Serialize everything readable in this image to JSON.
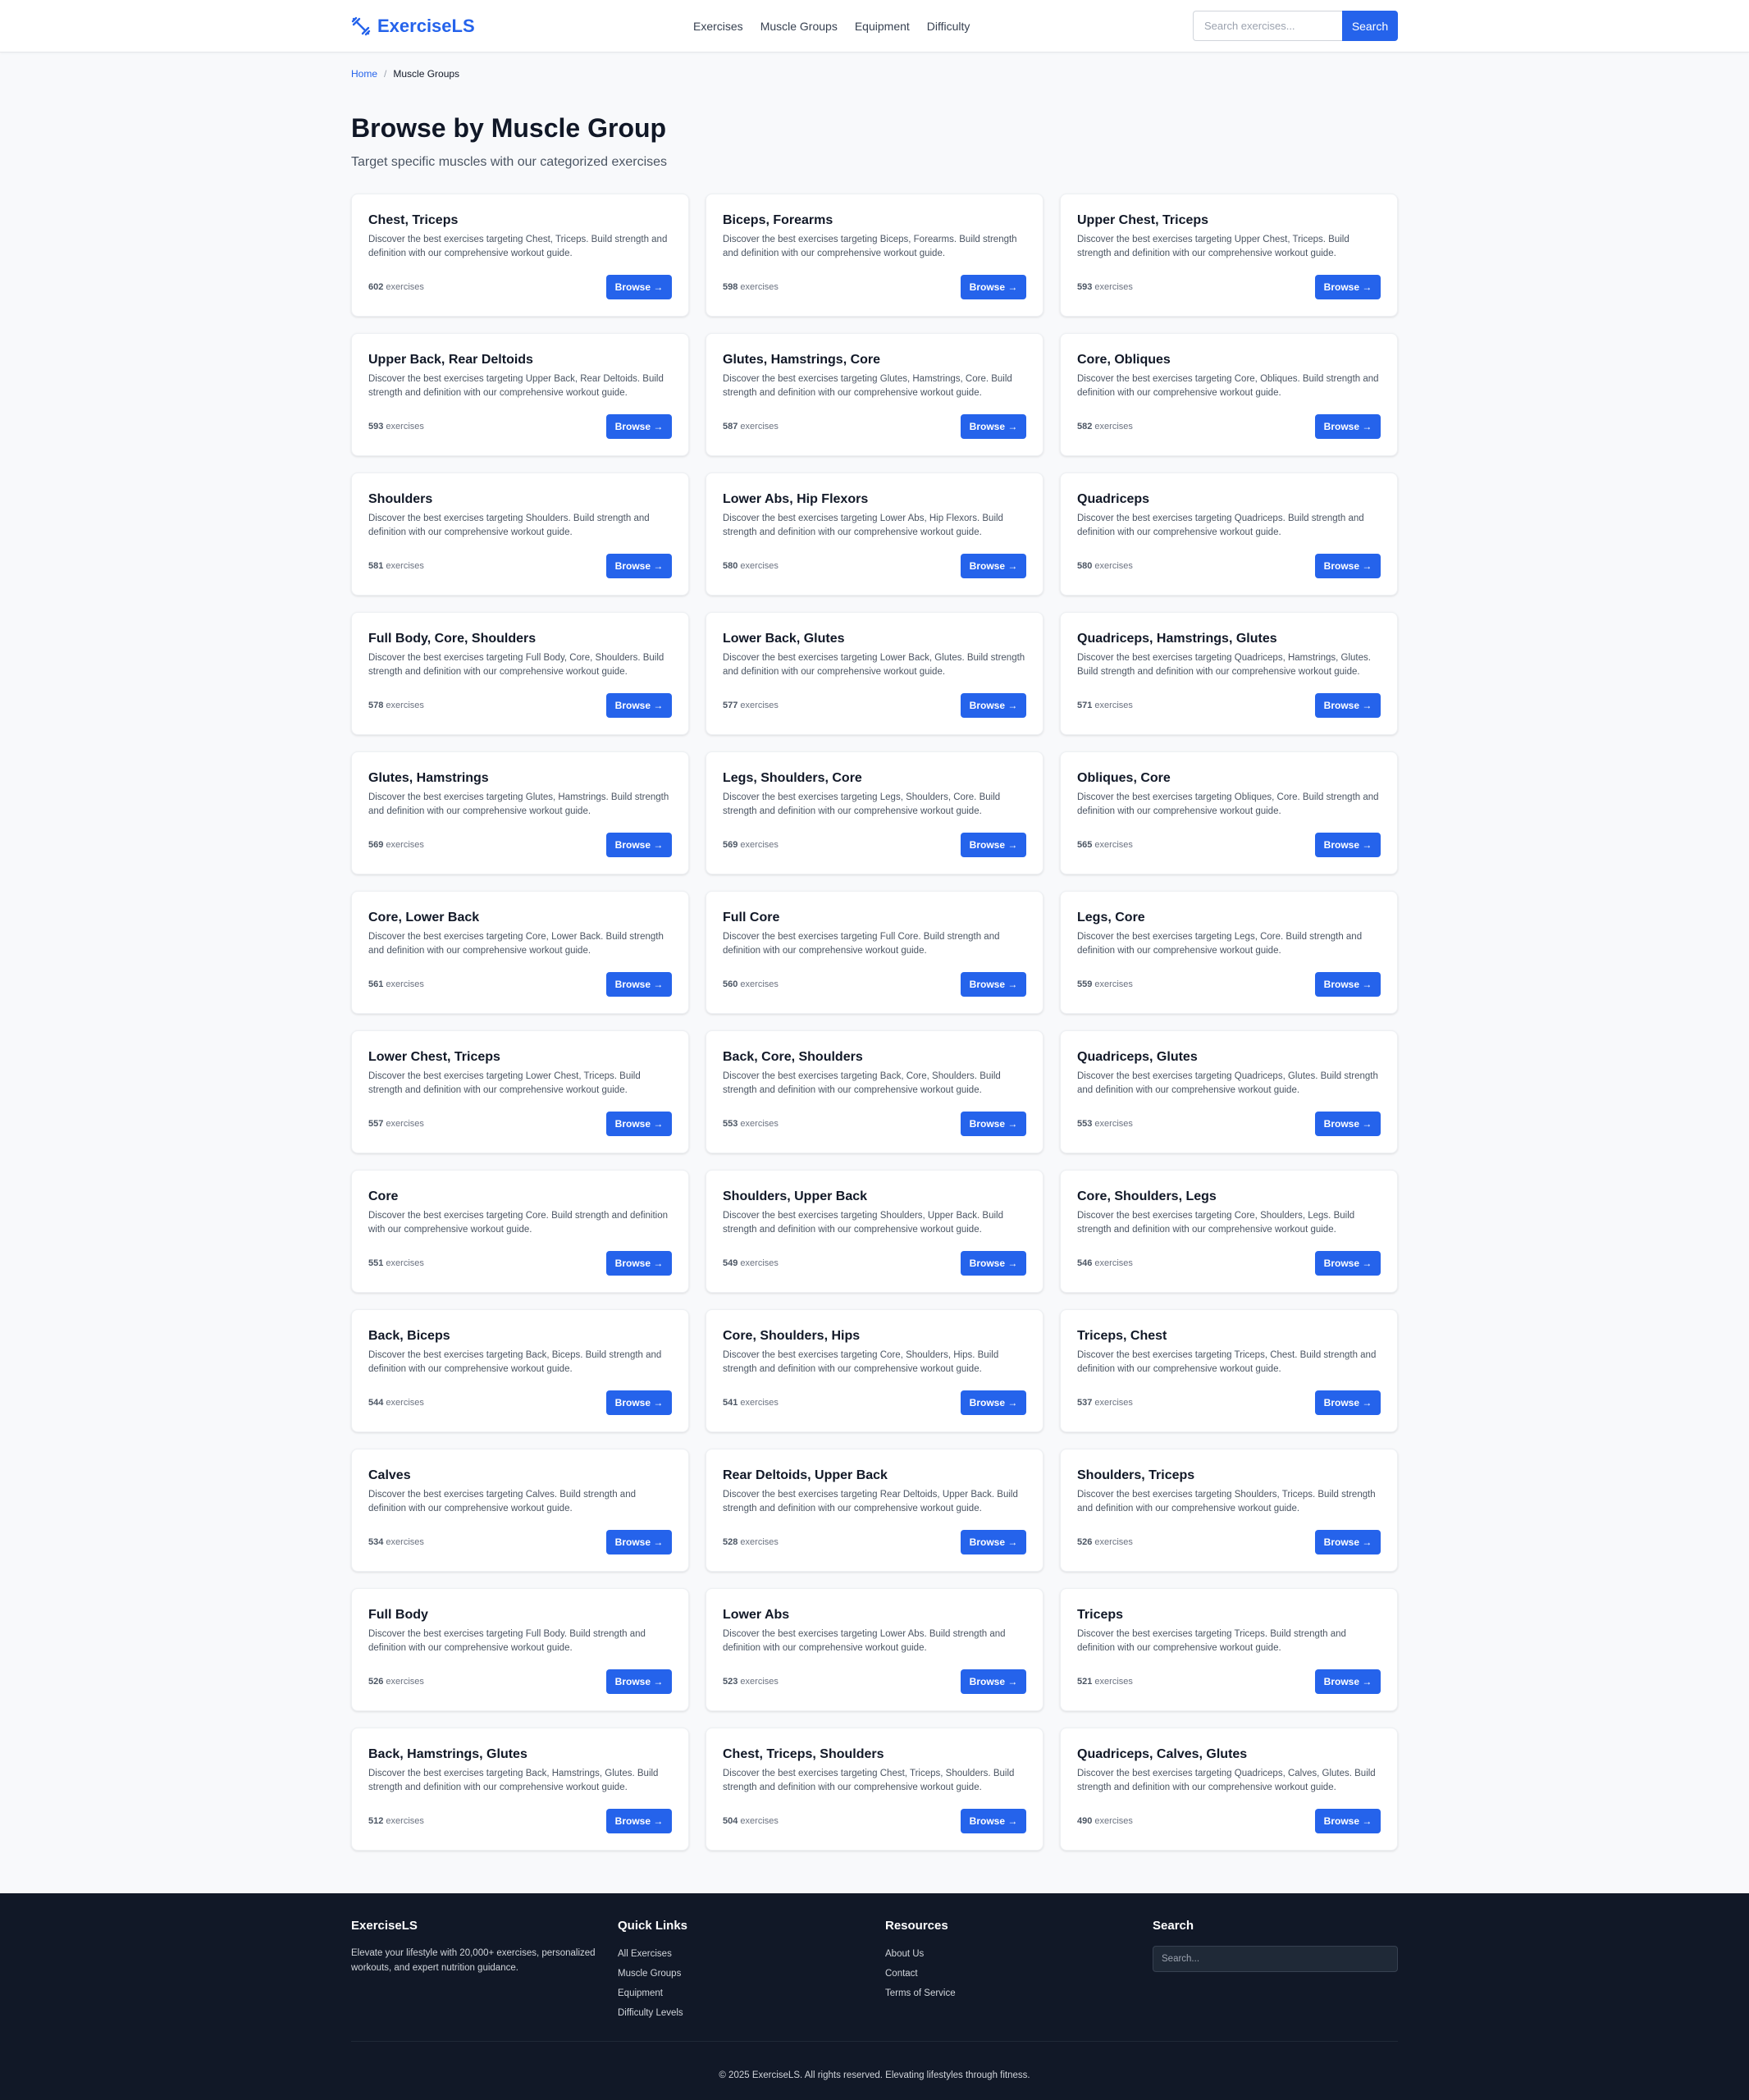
{
  "header": {
    "brand": "ExerciseLS",
    "brand_icon": "dumbbell-icon",
    "nav": [
      "Exercises",
      "Muscle Groups",
      "Equipment",
      "Difficulty"
    ],
    "search_placeholder": "Search exercises...",
    "search_button": "Search"
  },
  "breadcrumb": {
    "home": "Home",
    "separator": "/",
    "current": "Muscle Groups"
  },
  "page": {
    "title": "Browse by Muscle Group",
    "subtitle": "Target specific muscles with our categorized exercises"
  },
  "card_labels": {
    "count_suffix": " exercises",
    "button": "Browse →"
  },
  "cards": [
    {
      "title": "Chest, Triceps",
      "description": "Discover the best exercises targeting Chest, Triceps. Build strength and definition with our comprehensive workout guide.",
      "count": "602"
    },
    {
      "title": "Biceps, Forearms",
      "description": "Discover the best exercises targeting Biceps, Forearms. Build strength and definition with our comprehensive workout guide.",
      "count": "598"
    },
    {
      "title": "Upper Chest, Triceps",
      "description": "Discover the best exercises targeting Upper Chest, Triceps. Build strength and definition with our comprehensive workout guide.",
      "count": "593"
    },
    {
      "title": "Upper Back, Rear Deltoids",
      "description": "Discover the best exercises targeting Upper Back, Rear Deltoids. Build strength and definition with our comprehensive workout guide.",
      "count": "593"
    },
    {
      "title": "Glutes, Hamstrings, Core",
      "description": "Discover the best exercises targeting Glutes, Hamstrings, Core. Build strength and definition with our comprehensive workout guide.",
      "count": "587"
    },
    {
      "title": "Core, Obliques",
      "description": "Discover the best exercises targeting Core, Obliques. Build strength and definition with our comprehensive workout guide.",
      "count": "582"
    },
    {
      "title": "Shoulders",
      "description": "Discover the best exercises targeting Shoulders. Build strength and definition with our comprehensive workout guide.",
      "count": "581"
    },
    {
      "title": "Lower Abs, Hip Flexors",
      "description": "Discover the best exercises targeting Lower Abs, Hip Flexors. Build strength and definition with our comprehensive workout guide.",
      "count": "580"
    },
    {
      "title": "Quadriceps",
      "description": "Discover the best exercises targeting Quadriceps. Build strength and definition with our comprehensive workout guide.",
      "count": "580"
    },
    {
      "title": "Full Body, Core, Shoulders",
      "description": "Discover the best exercises targeting Full Body, Core, Shoulders. Build strength and definition with our comprehensive workout guide.",
      "count": "578"
    },
    {
      "title": "Lower Back, Glutes",
      "description": "Discover the best exercises targeting Lower Back, Glutes. Build strength and definition with our comprehensive workout guide.",
      "count": "577"
    },
    {
      "title": "Quadriceps, Hamstrings, Glutes",
      "description": "Discover the best exercises targeting Quadriceps, Hamstrings, Glutes. Build strength and definition with our comprehensive workout guide.",
      "count": "571"
    },
    {
      "title": "Glutes, Hamstrings",
      "description": "Discover the best exercises targeting Glutes, Hamstrings. Build strength and definition with our comprehensive workout guide.",
      "count": "569"
    },
    {
      "title": "Legs, Shoulders, Core",
      "description": "Discover the best exercises targeting Legs, Shoulders, Core. Build strength and definition with our comprehensive workout guide.",
      "count": "569"
    },
    {
      "title": "Obliques, Core",
      "description": "Discover the best exercises targeting Obliques, Core. Build strength and definition with our comprehensive workout guide.",
      "count": "565"
    },
    {
      "title": "Core, Lower Back",
      "description": "Discover the best exercises targeting Core, Lower Back. Build strength and definition with our comprehensive workout guide.",
      "count": "561"
    },
    {
      "title": "Full Core",
      "description": "Discover the best exercises targeting Full Core. Build strength and definition with our comprehensive workout guide.",
      "count": "560"
    },
    {
      "title": "Legs, Core",
      "description": "Discover the best exercises targeting Legs, Core. Build strength and definition with our comprehensive workout guide.",
      "count": "559"
    },
    {
      "title": "Lower Chest, Triceps",
      "description": "Discover the best exercises targeting Lower Chest, Triceps. Build strength and definition with our comprehensive workout guide.",
      "count": "557"
    },
    {
      "title": "Back, Core, Shoulders",
      "description": "Discover the best exercises targeting Back, Core, Shoulders. Build strength and definition with our comprehensive workout guide.",
      "count": "553"
    },
    {
      "title": "Quadriceps, Glutes",
      "description": "Discover the best exercises targeting Quadriceps, Glutes. Build strength and definition with our comprehensive workout guide.",
      "count": "553"
    },
    {
      "title": "Core",
      "description": "Discover the best exercises targeting Core. Build strength and definition with our comprehensive workout guide.",
      "count": "551"
    },
    {
      "title": "Shoulders, Upper Back",
      "description": "Discover the best exercises targeting Shoulders, Upper Back. Build strength and definition with our comprehensive workout guide.",
      "count": "549"
    },
    {
      "title": "Core, Shoulders, Legs",
      "description": "Discover the best exercises targeting Core, Shoulders, Legs. Build strength and definition with our comprehensive workout guide.",
      "count": "546"
    },
    {
      "title": "Back, Biceps",
      "description": "Discover the best exercises targeting Back, Biceps. Build strength and definition with our comprehensive workout guide.",
      "count": "544"
    },
    {
      "title": "Core, Shoulders, Hips",
      "description": "Discover the best exercises targeting Core, Shoulders, Hips. Build strength and definition with our comprehensive workout guide.",
      "count": "541"
    },
    {
      "title": "Triceps, Chest",
      "description": "Discover the best exercises targeting Triceps, Chest. Build strength and definition with our comprehensive workout guide.",
      "count": "537"
    },
    {
      "title": "Calves",
      "description": "Discover the best exercises targeting Calves. Build strength and definition with our comprehensive workout guide.",
      "count": "534"
    },
    {
      "title": "Rear Deltoids, Upper Back",
      "description": "Discover the best exercises targeting Rear Deltoids, Upper Back. Build strength and definition with our comprehensive workout guide.",
      "count": "528"
    },
    {
      "title": "Shoulders, Triceps",
      "description": "Discover the best exercises targeting Shoulders, Triceps. Build strength and definition with our comprehensive workout guide.",
      "count": "526"
    },
    {
      "title": "Full Body",
      "description": "Discover the best exercises targeting Full Body. Build strength and definition with our comprehensive workout guide.",
      "count": "526"
    },
    {
      "title": "Lower Abs",
      "description": "Discover the best exercises targeting Lower Abs. Build strength and definition with our comprehensive workout guide.",
      "count": "523"
    },
    {
      "title": "Triceps",
      "description": "Discover the best exercises targeting Triceps. Build strength and definition with our comprehensive workout guide.",
      "count": "521"
    },
    {
      "title": "Back, Hamstrings, Glutes",
      "description": "Discover the best exercises targeting Back, Hamstrings, Glutes. Build strength and definition with our comprehensive workout guide.",
      "count": "512"
    },
    {
      "title": "Chest, Triceps, Shoulders",
      "description": "Discover the best exercises targeting Chest, Triceps, Shoulders. Build strength and definition with our comprehensive workout guide.",
      "count": "504"
    },
    {
      "title": "Quadriceps, Calves, Glutes",
      "description": "Discover the best exercises targeting Quadriceps, Calves, Glutes. Build strength and definition with our comprehensive workout guide.",
      "count": "490"
    }
  ],
  "footer": {
    "about": {
      "title": "ExerciseLS",
      "text": "Elevate your lifestyle with 20,000+ exercises, personalized workouts, and expert nutrition guidance."
    },
    "quick_links": {
      "title": "Quick Links",
      "items": [
        "All Exercises",
        "Muscle Groups",
        "Equipment",
        "Difficulty Levels"
      ]
    },
    "resources": {
      "title": "Resources",
      "items": [
        "About Us",
        "Contact",
        "Terms of Service"
      ]
    },
    "search": {
      "title": "Search",
      "placeholder": "Search..."
    },
    "copyright": "© 2025 ExerciseLS. All rights reserved. Elevating lifestyles through fitness."
  },
  "colors": {
    "accent": "#2563eb",
    "footer_bg": "#111827",
    "page_bg": "#f8f9fb"
  }
}
